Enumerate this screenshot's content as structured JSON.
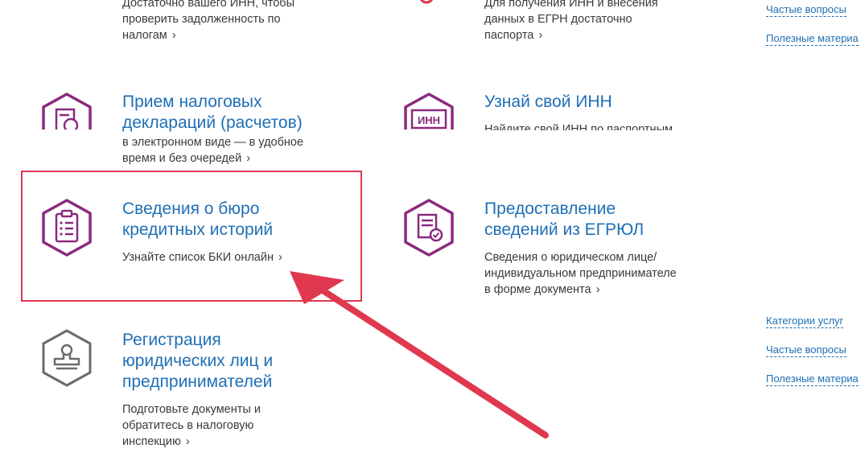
{
  "cards": {
    "top_left": {
      "desc_lines": [
        "Достаточно вашего ИНН, чтобы",
        "проверить задолженность по",
        "налогам"
      ]
    },
    "top_right": {
      "desc_lines": [
        "Для получения ИНН и внесения",
        "данных в ЕГРН достаточно",
        "паспорта"
      ]
    },
    "declarations": {
      "title_lines": [
        "Прием налоговых",
        "деклараций (расчетов)"
      ],
      "desc_lines": [
        "в электронном виде — в удобное",
        "время и без очередей"
      ]
    },
    "inn": {
      "title": "Узнай свой ИНН",
      "desc_partial": "Найдите свой ИНН по паспортным",
      "icon_text": "ИНН"
    },
    "bki": {
      "title_lines": [
        "Сведения о бюро",
        "кредитных историй"
      ],
      "desc": "Узнайте список БКИ онлайн"
    },
    "egrul": {
      "title_lines": [
        "Предоставление",
        "сведений из ЕГРЮЛ"
      ],
      "desc_lines": [
        "Сведения о юридическом лице/",
        "индивидуальном предпринимателе",
        "в форме документа"
      ]
    },
    "registration": {
      "title_lines": [
        "Регистрация",
        "юридических лиц и",
        "предпринимателей"
      ],
      "desc_lines": [
        "Подготовьте документы и",
        "обратитесь в налоговую",
        "инспекцию"
      ]
    }
  },
  "sidebar_top": {
    "faq": "Частые вопросы",
    "useful": "Полезные материа"
  },
  "sidebar_bottom": {
    "categories": "Категории услуг",
    "faq": "Частые вопросы",
    "useful": "Полезные материа"
  },
  "colors": {
    "accent_purple": "#8a2a7e",
    "link_blue": "#1f6fb5",
    "highlight_red": "#e0384e",
    "gray_icon": "#6b6b6b"
  }
}
